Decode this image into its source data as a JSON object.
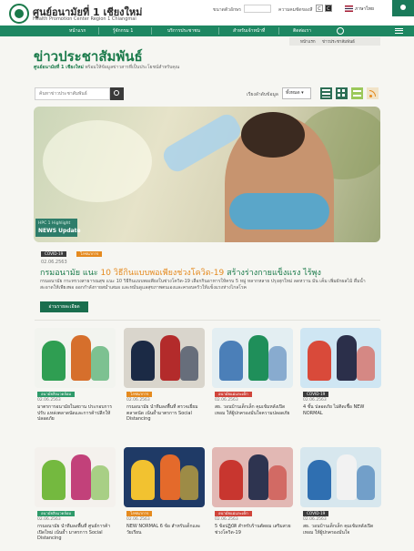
{
  "header": {
    "brand_title": "ศูนย์อนามัยที่ 1 เชียงใหม่",
    "brand_subtitle": "Health Promotion Center Region 1 Chiangmai",
    "font_size_label": "ขนาดตัวอักษร",
    "contrast_label": "ความคมชัดของสี",
    "language": "ภาษาไทย"
  },
  "nav": {
    "items": [
      "หน้าแรก",
      "รู้จักกรม 1",
      "บริการประชาชน",
      "สำหรับเจ้าหน้าที่",
      "ติดต่อเรา"
    ]
  },
  "breadcrumb": {
    "items": [
      "หน้าแรก",
      "ข่าวประชาสัมพันธ์"
    ]
  },
  "page": {
    "title": "ข่าวประชาสัมพันธ์",
    "subtitle_org": "ศูนย์อนามัยที่ 1 เชียงใหม่",
    "subtitle_text": "พร้อมให้ข้อมูลข่าวสารที่เป็นประโยชน์สำหรับคุณ"
  },
  "search": {
    "placeholder": "ค้นหาข่าวประชาสัมพันธ์"
  },
  "sort": {
    "label": "เรียงลำดับข้อมูล",
    "selected": "ทั้งหมด"
  },
  "hero": {
    "badge_small": "HPC 1 Highlight",
    "badge_main": "NEWS Update"
  },
  "featured": {
    "tags": [
      "COVID-19",
      "โภชนาการ"
    ],
    "date": "02.06.2563",
    "title_prefix": "กรมอนามัย แนะ ",
    "title_highlight": "10 วิธีกินแบบพอเพียงช่วงโควิด-19",
    "title_suffix": " สร้างร่างกายแข็งแรง ไร้พุง",
    "description": "กรมอนามัย กระทรวงสาธารณสุข แนะ 10 วิธีกินแบบพอเพียงในช่วงโควิด-19 เลือกกินอาหารให้ครบ 5 หมู่ หลากหลาย ปรุงสุกใหม่ ลดหวาน มัน เค็ม เพิ่มผักผลไม้ ดื่มน้ำสะอาดให้เพียงพอ ออกกำลังกายสม่ำเสมอ และหมั่นดูแลสุขภาพตนเองและครอบครัวให้แข็งแรงห่างไกลโรค",
    "read_more": "อ่านรายละเอียด"
  },
  "cards": [
    {
      "tag": "อนามัยสิ่งแวดล้อม",
      "tag_color": "green",
      "date": "02.06.2563",
      "title": "มาตรการอนามัยในสถาน ประกอบการ ปรับ แหล่งตลาดนัดและการค้าปลีกให้ปลอดภัย"
    },
    {
      "tag": "โภชนาการ",
      "tag_color": "orange",
      "date": "02.06.2563",
      "title": "กรมอนามัย นำทีมลงพื้นที่ ตรวจเยี่ยมตลาดนัด เน้นย้ำมาตรการ Social Distancing"
    },
    {
      "tag": "อนามัยแม่และเด็ก",
      "tag_color": "red",
      "date": "02.06.2563",
      "title": "สธ. วอนบ้านเด็กเล็ก คุมเข้มหลังเปิดเทอม ให้ผู้ปกครองมั่นใจความปลอดภัย"
    },
    {
      "tag": "COVID-19",
      "tag_color": "dark",
      "date": "02.06.2563",
      "title": "4 ชั้น ปลอดภัย ไม่ติดเชื้อ NEW NORMAL"
    },
    {
      "tag": "อนามัยสิ่งแวดล้อม",
      "tag_color": "green",
      "date": "02.06.2563",
      "title": "กรมอนามัย นำทีมลงพื้นที่ ศูนย์การค้าเปิดใหม่ เน้นย้ำ มาตรการ Social Distancing"
    },
    {
      "tag": "โภชนาการ",
      "tag_color": "orange",
      "date": "02.06.2563",
      "title": "NEW NORMAL 6 ข้อ สำหรับเด็กและวัยเรียน"
    },
    {
      "tag": "อนามัยแม่และเด็ก",
      "tag_color": "red",
      "date": "02.06.2563",
      "title": "5 ข้อปฏิบัติ สำหรับร้านตัดผม เสริมสวย ช่วงโควิด-19"
    },
    {
      "tag": "COVID-19",
      "tag_color": "dark",
      "date": "02.06.2563",
      "title": "สธ. วอนบ้านเด็กเล็ก คุมเข้มหลังเปิดเทอม ให้ผู้ปกครองมั่นใจ"
    }
  ],
  "colors": {
    "brand_green": "#1a7a4a",
    "nav_green": "#1e8762",
    "accent_orange": "#e58a1f"
  }
}
